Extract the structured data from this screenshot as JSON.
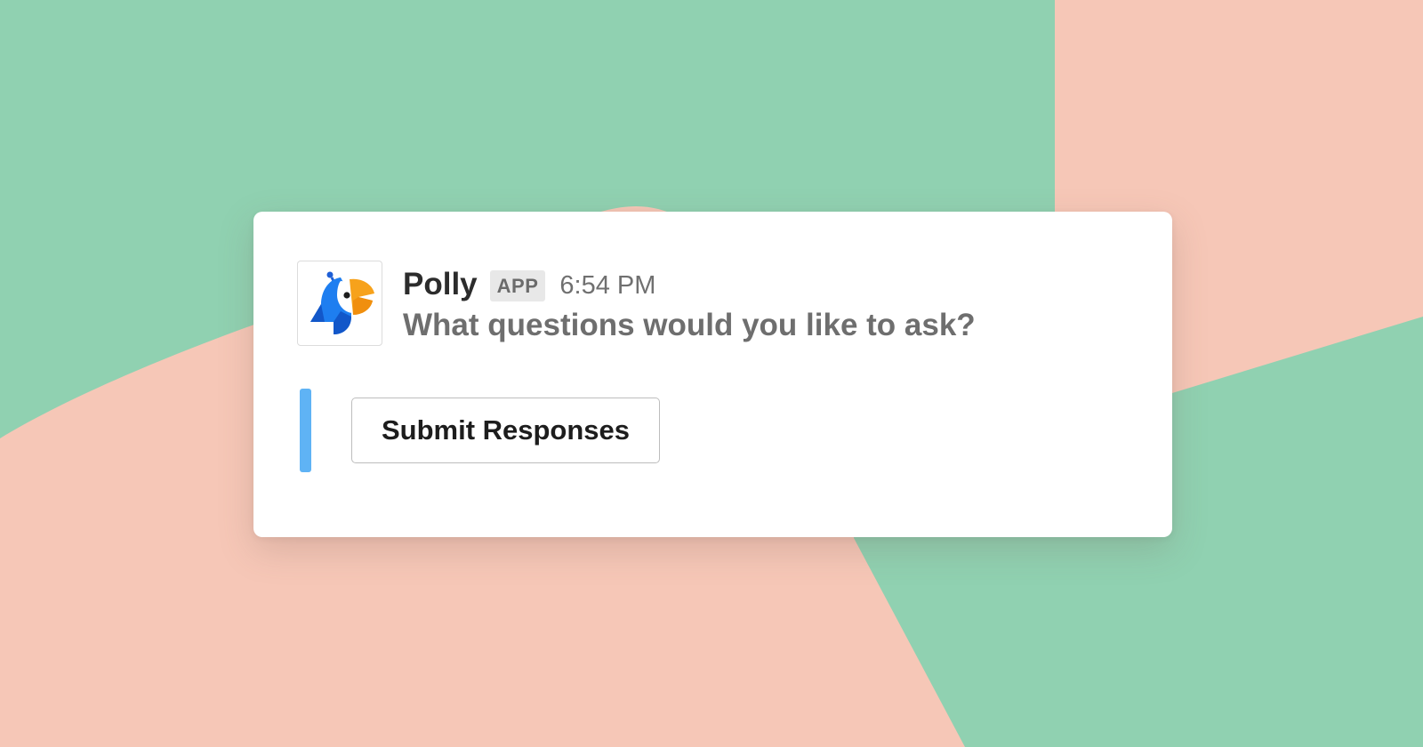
{
  "colors": {
    "background_green": "#90d1b1",
    "background_salmon": "#f6c7b7",
    "card": "#ffffff",
    "accent_bar": "#5fb3f5",
    "badge_bg": "#e8e8e8"
  },
  "message": {
    "sender": "Polly",
    "badge": "APP",
    "timestamp": "6:54 PM",
    "text": "What questions would you like to ask?",
    "avatar_icon": "polly-parrot-logo"
  },
  "attachment": {
    "button_label": "Submit Responses"
  }
}
